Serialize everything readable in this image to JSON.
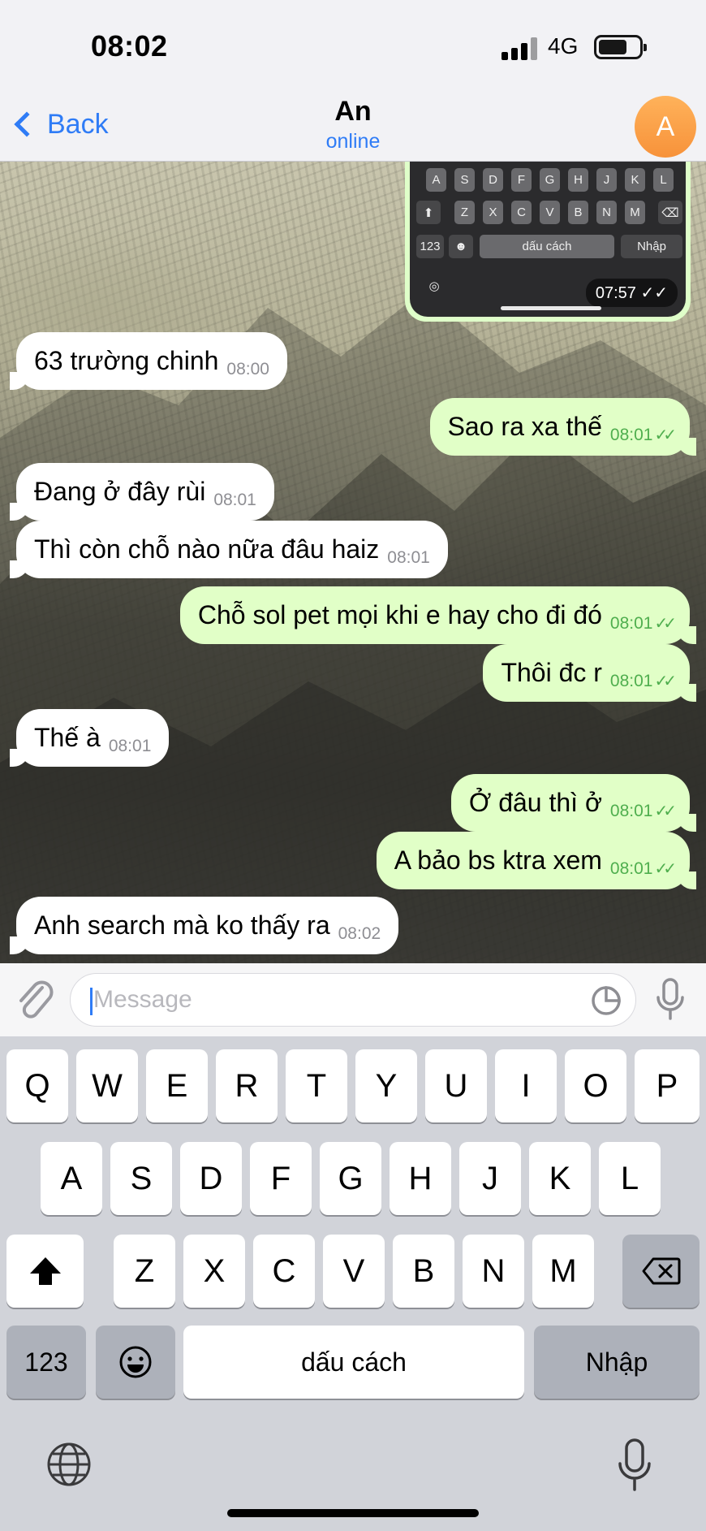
{
  "status_bar": {
    "time": "08:02",
    "network": "4G"
  },
  "header": {
    "back_label": "Back",
    "contact_name": "An",
    "contact_status": "online",
    "avatar_letter": "A",
    "accent_color": "#2f7cf6"
  },
  "screenshot_bubble": {
    "rows": [
      [
        "A",
        "S",
        "D",
        "F",
        "G",
        "H",
        "J",
        "K",
        "L"
      ],
      [
        "Z",
        "X",
        "C",
        "V",
        "B",
        "N",
        "M"
      ]
    ],
    "mode_key": "123",
    "space_key": "dấu cách",
    "return_key": "Nhập",
    "time": "07:57"
  },
  "messages": [
    {
      "dir": "in",
      "text": "63 trường chinh",
      "time": "08:00"
    },
    {
      "dir": "out",
      "text": "Sao ra xa thế",
      "time": "08:01",
      "read": true
    },
    {
      "dir": "in",
      "text": "Đang ở đây rùi",
      "time": "08:01"
    },
    {
      "dir": "in",
      "text": "Thì còn chỗ nào nữa đâu haiz",
      "time": "08:01"
    },
    {
      "dir": "out",
      "text": "Chỗ sol pet mọi khi e hay cho đi đó",
      "time": "08:01",
      "read": true
    },
    {
      "dir": "out",
      "text": "Thôi đc r",
      "time": "08:01",
      "read": true
    },
    {
      "dir": "in",
      "text": "Thế à",
      "time": "08:01"
    },
    {
      "dir": "out",
      "text": "Ở đâu thì ở",
      "time": "08:01",
      "read": true
    },
    {
      "dir": "out",
      "text": "A bảo bs ktra xem",
      "time": "08:01",
      "read": true
    },
    {
      "dir": "in",
      "text": "Anh search mà ko thấy ra",
      "time": "08:02"
    }
  ],
  "input": {
    "placeholder": "Message"
  },
  "keyboard": {
    "row1": [
      "Q",
      "W",
      "E",
      "R",
      "T",
      "Y",
      "U",
      "I",
      "O",
      "P"
    ],
    "row2": [
      "A",
      "S",
      "D",
      "F",
      "G",
      "H",
      "J",
      "K",
      "L"
    ],
    "row3": [
      "Z",
      "X",
      "C",
      "V",
      "B",
      "N",
      "M"
    ],
    "mode_key": "123",
    "space_key": "dấu cách",
    "return_key": "Nhập"
  },
  "colors": {
    "outgoing_bubble": "#e1ffc7",
    "incoming_bubble": "#ffffff",
    "read_tick": "#4fae4e"
  }
}
